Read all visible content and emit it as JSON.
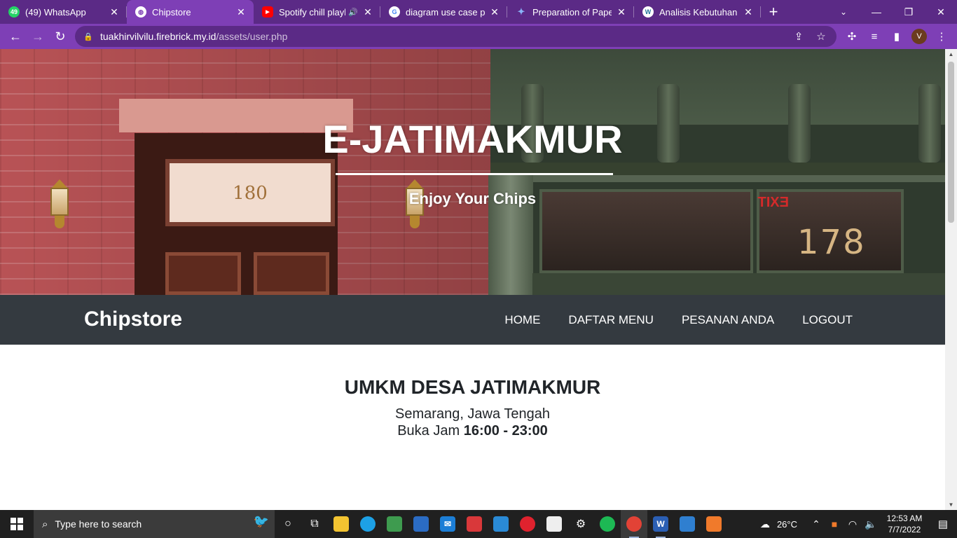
{
  "browser": {
    "tabs": [
      {
        "title": "(49) WhatsApp",
        "icon": "whatsapp-icon",
        "badge": "49",
        "color": "#25d366"
      },
      {
        "title": "Chipstore",
        "icon": "globe-icon",
        "badge": "",
        "color": "#ffffff",
        "active": true
      },
      {
        "title": "Spotify chill playlis",
        "icon": "youtube-icon",
        "badge": "▶",
        "color": "#ff0000",
        "audio": "🔊"
      },
      {
        "title": "diagram use case peng",
        "icon": "google-icon",
        "badge": "G",
        "color": "#4285f4"
      },
      {
        "title": "Preparation of Papers",
        "icon": "papers-icon",
        "badge": "✦",
        "color": "#8ab4f8"
      },
      {
        "title": "Analisis Kebutuhan Sis",
        "icon": "wordpress-icon",
        "badge": "W",
        "color": "#21759b"
      }
    ],
    "close_glyph": "✕",
    "newtab_glyph": "+",
    "url_host": "tuakhirvilvilu.firebrick.my.id",
    "url_path": "/assets/user.php",
    "profile_initial": "V"
  },
  "hero": {
    "title": "E-JATIMAKMUR",
    "subtitle": "Enjoy Your Chips",
    "door_number": "180",
    "street_number": "178",
    "exit_sign": "EXIT"
  },
  "navbar": {
    "brand": "Chipstore",
    "links": [
      "HOME",
      "DAFTAR MENU",
      "PESANAN ANDA",
      "LOGOUT"
    ]
  },
  "info": {
    "heading": "UMKM DESA JATIMAKMUR",
    "location": "Semarang, Jawa Tengah",
    "hours_label": "Buka Jam",
    "hours_value": "16:00 - 23:00"
  },
  "taskbar": {
    "search_placeholder": "Type here to search",
    "weather": "26°C",
    "time": "12:53 AM",
    "date": "7/7/2022"
  }
}
